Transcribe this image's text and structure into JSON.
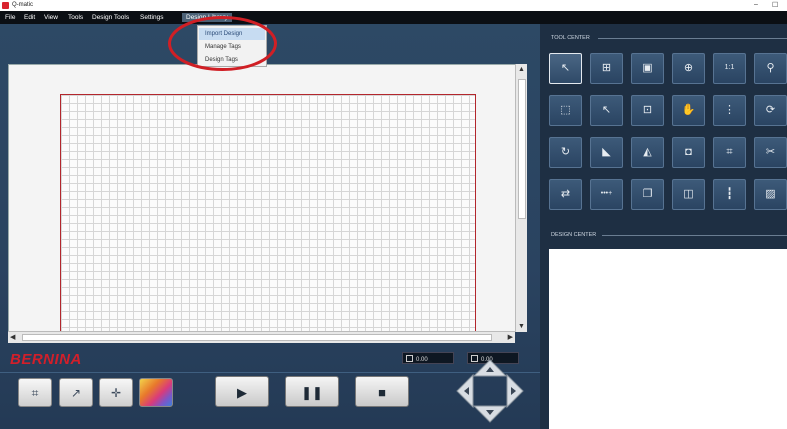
{
  "window": {
    "title": "Q-matic",
    "minimize": "–",
    "restore": "☐"
  },
  "menu": {
    "items": [
      {
        "key": "file",
        "label": "File"
      },
      {
        "key": "edit",
        "label": "Edit"
      },
      {
        "key": "view",
        "label": "View"
      },
      {
        "key": "tools",
        "label": "Tools"
      },
      {
        "key": "design_tools",
        "label": "Design Tools"
      },
      {
        "key": "settings",
        "label": "Settings"
      },
      {
        "key": "design_library",
        "label": "Design Library"
      }
    ],
    "open_menu": "Design Library"
  },
  "dropdown": {
    "items": [
      {
        "label": "Import Design",
        "highlighted": true
      },
      {
        "label": "Manage Tags",
        "highlighted": false
      },
      {
        "label": "Design Tags",
        "highlighted": false
      }
    ]
  },
  "brand": "BERNINA",
  "coords": {
    "x_value": "0.00",
    "y_value": "0.00"
  },
  "right_panel": {
    "tool_center_label": "TOOL CENTER",
    "design_center_label": "DESIGN CENTER"
  },
  "tools": [
    {
      "icon": "pointer-icon",
      "glyph": "↖",
      "active": true
    },
    {
      "icon": "add-layer-icon",
      "glyph": "⊞"
    },
    {
      "icon": "layer-order-icon",
      "glyph": "▣"
    },
    {
      "icon": "move-target-icon",
      "glyph": "⊕"
    },
    {
      "icon": "actual-size-icon",
      "glyph": "1:1"
    },
    {
      "icon": "zoom-icon",
      "glyph": "⚲"
    },
    {
      "icon": "resize-icon",
      "glyph": "⬚"
    },
    {
      "icon": "node-edit-icon",
      "glyph": "↖"
    },
    {
      "icon": "fit-box-icon",
      "glyph": "⊡"
    },
    {
      "icon": "pan-hand-icon",
      "glyph": "✋"
    },
    {
      "icon": "distribute-icon",
      "glyph": "⋮"
    },
    {
      "icon": "rotate-view-icon",
      "glyph": "⟳"
    },
    {
      "icon": "rotate-icon",
      "glyph": "↻"
    },
    {
      "icon": "flip-horizontal-icon",
      "glyph": "◣"
    },
    {
      "icon": "mirror-icon",
      "glyph": "◭"
    },
    {
      "icon": "crop-shape-icon",
      "glyph": "◘"
    },
    {
      "icon": "expand-icon",
      "glyph": "⌗"
    },
    {
      "icon": "scissors-icon",
      "glyph": "✂"
    },
    {
      "icon": "repeat-icon",
      "glyph": "⇄"
    },
    {
      "icon": "stitch-plus-icon",
      "glyph": "•••+"
    },
    {
      "icon": "duplicate-icon",
      "glyph": "❐"
    },
    {
      "icon": "spacing-icon",
      "glyph": "◫"
    },
    {
      "icon": "ruler-icon",
      "glyph": "┇"
    },
    {
      "icon": "image-icon",
      "glyph": "▨"
    }
  ],
  "controls": {
    "left": [
      {
        "icon": "crop-frame-icon",
        "glyph": "⌗"
      },
      {
        "icon": "needle-icon",
        "glyph": "↗"
      },
      {
        "icon": "crosshair-icon",
        "glyph": "✛"
      },
      {
        "icon": "color-palette-icon",
        "glyph": ""
      }
    ],
    "playback": [
      {
        "icon": "play-icon",
        "glyph": "▶"
      },
      {
        "icon": "pause-icon",
        "glyph": "❚❚"
      },
      {
        "icon": "stop-icon",
        "glyph": "■"
      }
    ]
  },
  "colors": {
    "accent_red": "#d21f2a",
    "panel_blue": "#2d4965",
    "dark_panel": "#1e2f43"
  }
}
